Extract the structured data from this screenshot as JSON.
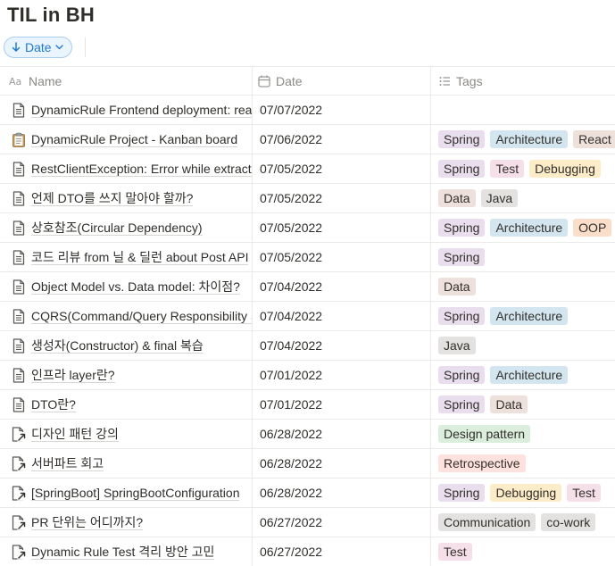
{
  "page": {
    "title": "TIL in BH"
  },
  "toolbar": {
    "sort_label": "Date"
  },
  "table": {
    "columns": {
      "name": "Name",
      "date": "Date",
      "tags": "Tags"
    },
    "tag_colors": {
      "Spring": "#e8deee",
      "Architecture": "#d3e5ef",
      "React": "#eee0da",
      "Test": "#f5e0e9",
      "Debugging": "#fdecc8",
      "Data": "#eee0da",
      "Java": "#e3e2e0",
      "OOP": "#fadec9",
      "Design pattern": "#dbeddb",
      "Retrospective": "#ffe2dd",
      "Communication": "#e3e2e0",
      "co-work": "#e3e2e0"
    },
    "rows": [
      {
        "name": "DynamicRule Frontend deployment: react",
        "date": "07/07/2022",
        "tags": [],
        "icon": "page"
      },
      {
        "name": "DynamicRule Project - Kanban board",
        "date": "07/06/2022",
        "tags": [
          "Spring",
          "Architecture",
          "React"
        ],
        "icon": "clipboard"
      },
      {
        "name": "RestClientException: Error while extracting response",
        "date": "07/05/2022",
        "tags": [
          "Spring",
          "Test",
          "Debugging"
        ],
        "icon": "page"
      },
      {
        "name": "언제 DTO를 쓰지 말아야 할까?",
        "date": "07/05/2022",
        "tags": [
          "Data",
          "Java"
        ],
        "icon": "page"
      },
      {
        "name": "상호참조(Circular Dependency)",
        "date": "07/05/2022",
        "tags": [
          "Spring",
          "Architecture",
          "OOP"
        ],
        "icon": "page"
      },
      {
        "name": "코드 리뷰 from 닐 & 딜런 about Post API",
        "date": "07/05/2022",
        "tags": [
          "Spring"
        ],
        "icon": "page"
      },
      {
        "name": "Object Model vs. Data model: 차이점?",
        "date": "07/04/2022",
        "tags": [
          "Data"
        ],
        "icon": "page"
      },
      {
        "name": "CQRS(Command/Query Responsibility Segregation)",
        "date": "07/04/2022",
        "tags": [
          "Spring",
          "Architecture"
        ],
        "icon": "page"
      },
      {
        "name": "생성자(Constructor) & final 복습",
        "date": "07/04/2022",
        "tags": [
          "Java"
        ],
        "icon": "page"
      },
      {
        "name": "인프라 layer란?",
        "date": "07/01/2022",
        "tags": [
          "Spring",
          "Architecture"
        ],
        "icon": "page"
      },
      {
        "name": "DTO란?",
        "date": "07/01/2022",
        "tags": [
          "Spring",
          "Data"
        ],
        "icon": "page"
      },
      {
        "name": "디자인 패턴 강의",
        "date": "06/28/2022",
        "tags": [
          "Design pattern"
        ],
        "icon": "link"
      },
      {
        "name": "서버파트 회고",
        "date": "06/28/2022",
        "tags": [
          "Retrospective"
        ],
        "icon": "link"
      },
      {
        "name": "[SpringBoot] SpringBootConfiguration",
        "date": "06/28/2022",
        "tags": [
          "Spring",
          "Debugging",
          "Test"
        ],
        "icon": "link"
      },
      {
        "name": "PR 단위는 어디까지?",
        "date": "06/27/2022",
        "tags": [
          "Communication",
          "co-work"
        ],
        "icon": "link"
      },
      {
        "name": "Dynamic Rule Test 격리 방안 고민",
        "date": "06/27/2022",
        "tags": [
          "Test"
        ],
        "icon": "link"
      }
    ]
  }
}
